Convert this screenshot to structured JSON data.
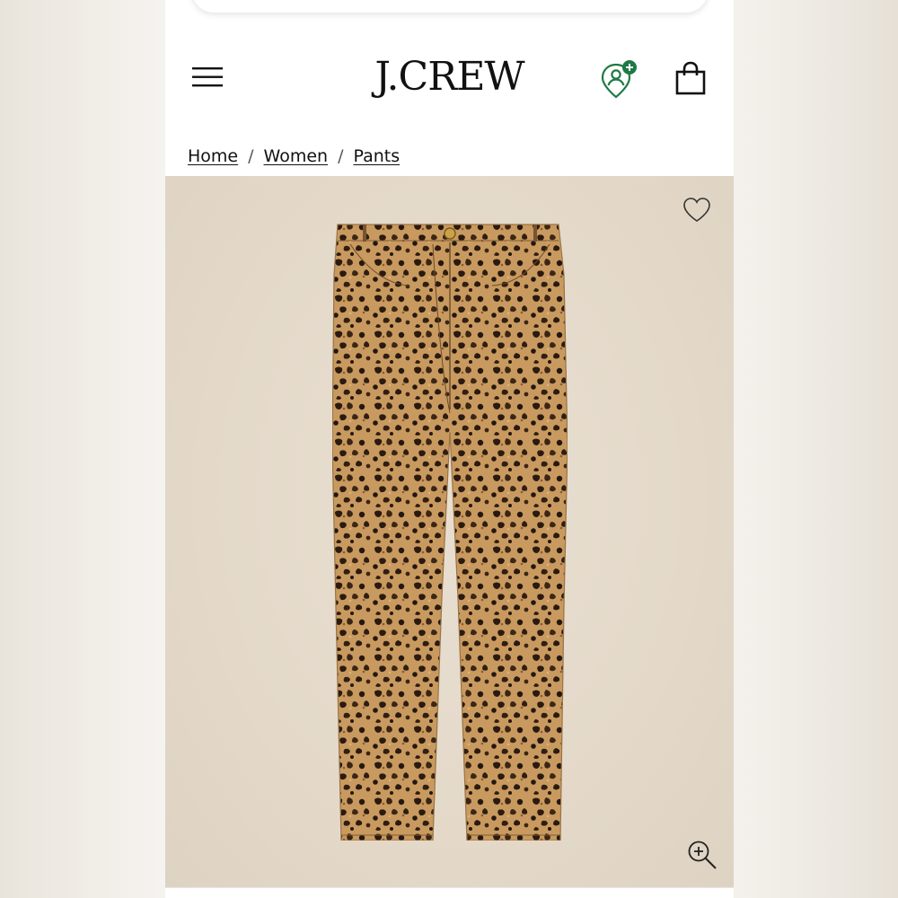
{
  "brand": {
    "logo_text": "J.CREW"
  },
  "header": {
    "menu_icon": "hamburger-menu-icon",
    "account_icon": "account-add-icon",
    "bag_icon": "shopping-bag-icon",
    "account_badge_color": "#1e7a45"
  },
  "breadcrumb": {
    "items": [
      "Home",
      "Women",
      "Pants"
    ],
    "separator": "/"
  },
  "product": {
    "background_color": "#e5dbcc",
    "wishlist_icon": "heart-icon",
    "zoom_icon": "zoom-in-icon",
    "pattern": "leopard-print"
  }
}
